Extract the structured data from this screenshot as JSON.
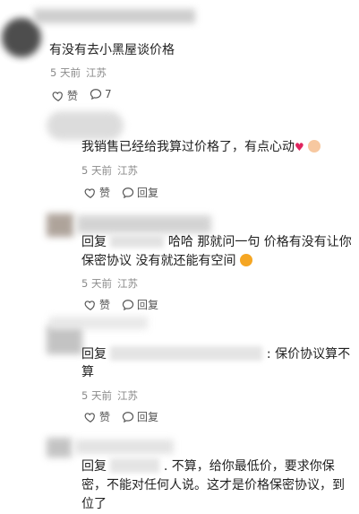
{
  "comment1": {
    "text": "有没有去小黑屋谈价格",
    "time": "5 天前",
    "location": "江苏",
    "like_label": "赞",
    "reply_count": "7"
  },
  "reply1": {
    "text": "我销售已经给我算过价格了，有点心动",
    "time": "5 天前",
    "location": "江苏",
    "like_label": "赞",
    "reply_label": "回复"
  },
  "reply2": {
    "prefix": "回复",
    "line1_tail": "哈哈 那就问一句 价格有没有让你",
    "line2": "保密协议 没有就还能有空间",
    "time": "5 天前",
    "location": "江苏",
    "like_label": "赞",
    "reply_label": "回复"
  },
  "reply3": {
    "prefix": "回复",
    "line1_tail": ": 保价协议算不",
    "line2": "算",
    "time": "5 天前",
    "location": "江苏",
    "like_label": "赞",
    "reply_label": "回复"
  },
  "reply4": {
    "prefix": "回复",
    "line1_tail": ". 不算，给你最低价，要求你保",
    "line2": "密，不能对任何人说。这才是价格保密协议，到",
    "line3": "位了"
  },
  "colors": {
    "text": "#1f1f1f",
    "meta": "#8a8a8a",
    "heart": "#e0245e"
  }
}
